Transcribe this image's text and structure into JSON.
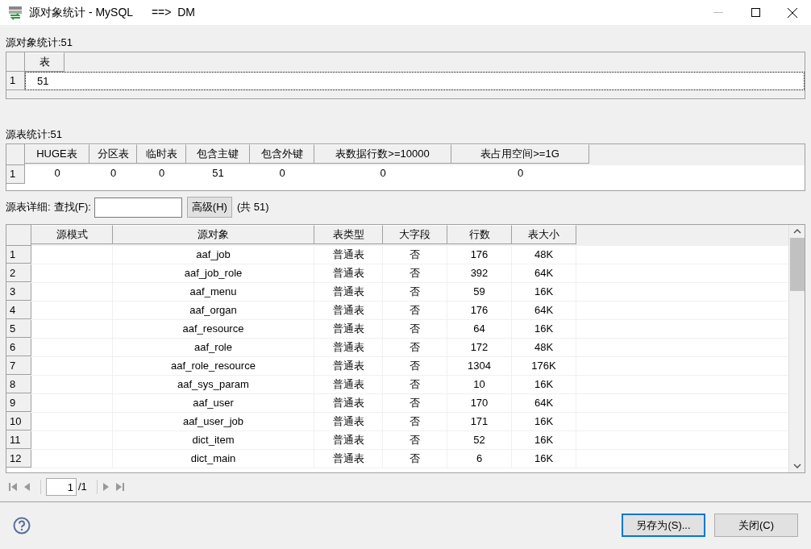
{
  "window": {
    "title": "源对象统计 - MySQL      ==>  DM"
  },
  "object_stats": {
    "label": "源对象统计:51",
    "columns": [
      "表"
    ],
    "rows": [
      {
        "index": "1",
        "cells": [
          "51"
        ]
      }
    ]
  },
  "table_stats": {
    "label": "源表统计:51",
    "columns": [
      "HUGE表",
      "分区表",
      "临时表",
      "包含主键",
      "包含外键",
      "表数据行数>=10000",
      "表占用空间>=1G"
    ],
    "rows": [
      {
        "index": "1",
        "cells": [
          "0",
          "0",
          "0",
          "51",
          "0",
          "0",
          "0"
        ]
      }
    ]
  },
  "detail_bar": {
    "label": "源表详细:",
    "search_label": "查找(F):",
    "advanced_button": "高级(H)",
    "total": "(共 51)"
  },
  "detail_table": {
    "columns": [
      "源模式",
      "源对象",
      "表类型",
      "大字段",
      "行数",
      "表大小"
    ],
    "rows": [
      {
        "index": "1",
        "cells": [
          "",
          "aaf_job",
          "普通表",
          "否",
          "176",
          "48K"
        ]
      },
      {
        "index": "2",
        "cells": [
          "",
          "aaf_job_role",
          "普通表",
          "否",
          "392",
          "64K"
        ]
      },
      {
        "index": "3",
        "cells": [
          "",
          "aaf_menu",
          "普通表",
          "否",
          "59",
          "16K"
        ]
      },
      {
        "index": "4",
        "cells": [
          "",
          "aaf_organ",
          "普通表",
          "否",
          "176",
          "64K"
        ]
      },
      {
        "index": "5",
        "cells": [
          "",
          "aaf_resource",
          "普通表",
          "否",
          "64",
          "16K"
        ]
      },
      {
        "index": "6",
        "cells": [
          "",
          "aaf_role",
          "普通表",
          "否",
          "172",
          "48K"
        ]
      },
      {
        "index": "7",
        "cells": [
          "",
          "aaf_role_resource",
          "普通表",
          "否",
          "1304",
          "176K"
        ]
      },
      {
        "index": "8",
        "cells": [
          "",
          "aaf_sys_param",
          "普通表",
          "否",
          "10",
          "16K"
        ]
      },
      {
        "index": "9",
        "cells": [
          "",
          "aaf_user",
          "普通表",
          "否",
          "170",
          "64K"
        ]
      },
      {
        "index": "10",
        "cells": [
          "",
          "aaf_user_job",
          "普通表",
          "否",
          "171",
          "16K"
        ]
      },
      {
        "index": "11",
        "cells": [
          "",
          "dict_item",
          "普通表",
          "否",
          "52",
          "16K"
        ]
      },
      {
        "index": "12",
        "cells": [
          "",
          "dict_main",
          "普通表",
          "否",
          "6",
          "16K"
        ]
      }
    ]
  },
  "pager": {
    "page": "1",
    "total": "/1"
  },
  "buttons": [
    {
      "label": "另存为(S)...",
      "selected": true
    },
    {
      "label": "关闭(C)",
      "selected": false
    }
  ]
}
